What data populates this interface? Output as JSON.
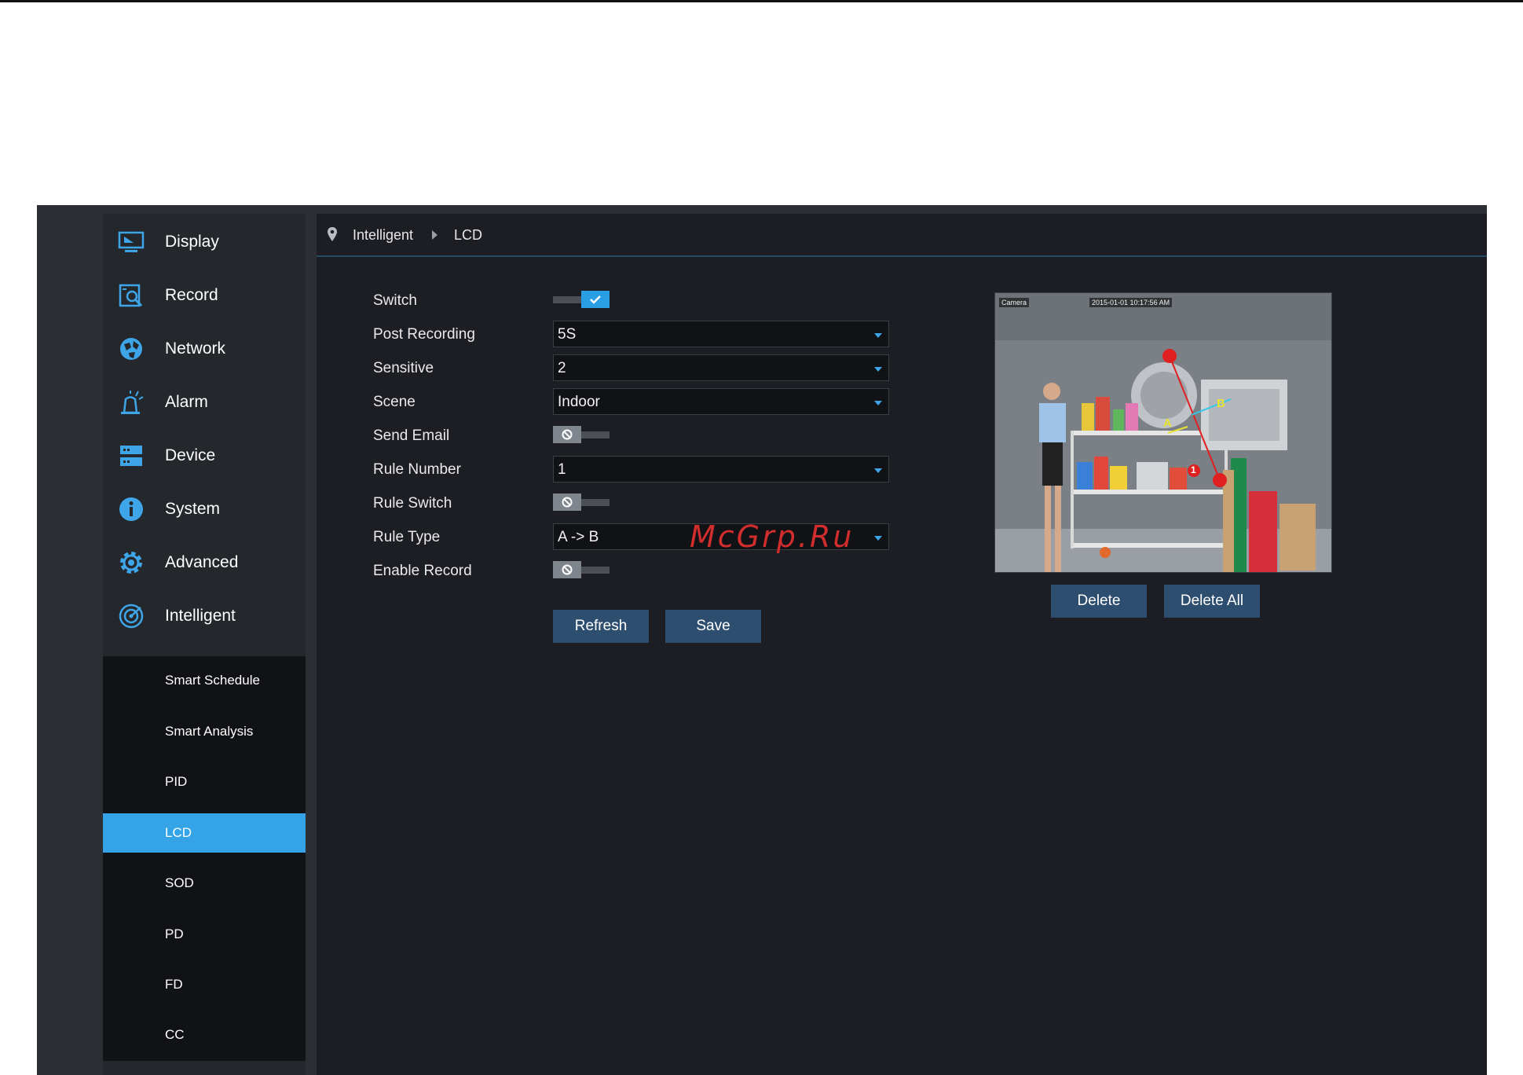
{
  "sidebar": {
    "items": [
      {
        "label": "Display",
        "icon": "monitor-icon"
      },
      {
        "label": "Record",
        "icon": "record-search-icon"
      },
      {
        "label": "Network",
        "icon": "globe-icon"
      },
      {
        "label": "Alarm",
        "icon": "siren-icon"
      },
      {
        "label": "Device",
        "icon": "storage-device-icon"
      },
      {
        "label": "System",
        "icon": "info-icon"
      },
      {
        "label": "Advanced",
        "icon": "gear-icon"
      },
      {
        "label": "Intelligent",
        "icon": "radar-icon"
      }
    ],
    "submenu": [
      {
        "label": "Smart Schedule"
      },
      {
        "label": "Smart Analysis"
      },
      {
        "label": "PID"
      },
      {
        "label": "LCD",
        "active": true
      },
      {
        "label": "SOD"
      },
      {
        "label": "PD"
      },
      {
        "label": "FD"
      },
      {
        "label": "CC"
      }
    ]
  },
  "breadcrumb": {
    "parent": "Intelligent",
    "current": "LCD"
  },
  "form": {
    "switch_label": "Switch",
    "switch_on": true,
    "post_recording_label": "Post Recording",
    "post_recording_value": "5S",
    "sensitive_label": "Sensitive",
    "sensitive_value": "2",
    "scene_label": "Scene",
    "scene_value": "Indoor",
    "send_email_label": "Send Email",
    "send_email_on": false,
    "rule_number_label": "Rule Number",
    "rule_number_value": "1",
    "rule_switch_label": "Rule Switch",
    "rule_switch_on": false,
    "rule_type_label": "Rule Type",
    "rule_type_value": "A -> B",
    "enable_record_label": "Enable Record",
    "enable_record_on": false
  },
  "buttons": {
    "refresh": "Refresh",
    "save": "Save",
    "delete": "Delete",
    "delete_all": "Delete All"
  },
  "preview": {
    "camera_label": "Camera",
    "timestamp": "2015-01-01 10:17:56 AM",
    "line_point_a": "A",
    "line_point_b": "B",
    "rule_index": "1"
  },
  "watermark": "McGrp.Ru",
  "colors": {
    "accent": "#35a4e7",
    "button": "#2e4e6f",
    "panel": "#1c1e23",
    "sidebar": "#24272c",
    "line": "#e02020"
  }
}
